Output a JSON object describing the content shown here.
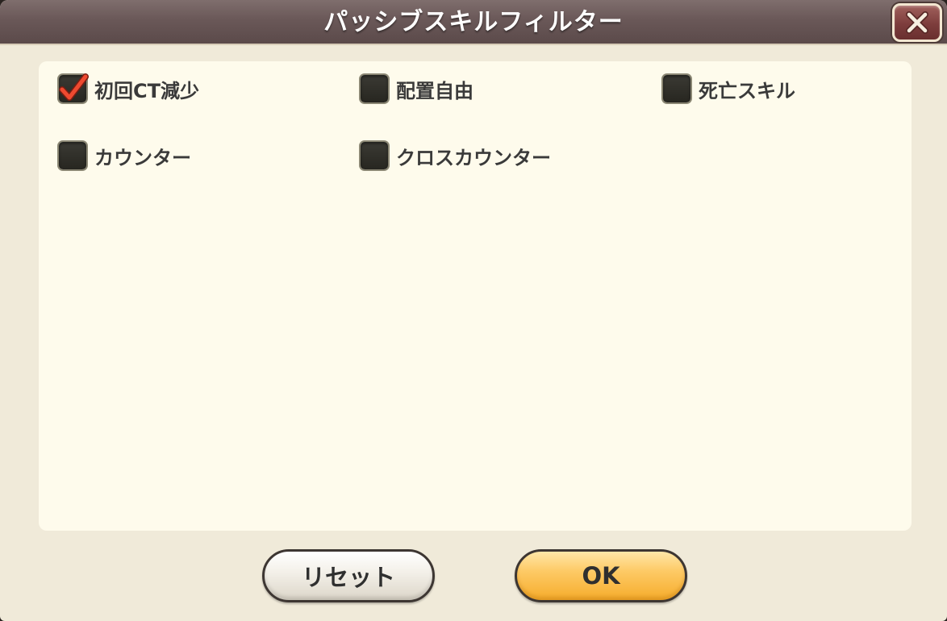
{
  "dialog": {
    "title": "パッシブスキルフィルター",
    "close_icon": "close-x-icon"
  },
  "filters": [
    {
      "label": "初回CT減少",
      "checked": true
    },
    {
      "label": "配置自由",
      "checked": false
    },
    {
      "label": "死亡スキル",
      "checked": false
    },
    {
      "label": "カウンター",
      "checked": false
    },
    {
      "label": "クロスカウンター",
      "checked": false
    }
  ],
  "buttons": {
    "reset_label": "リセット",
    "ok_label": "OK"
  },
  "colors": {
    "title_bar": "#6a5858",
    "panel_bg": "#fefbec",
    "check_red": "#e8412c",
    "ok_button": "#fdca66"
  }
}
